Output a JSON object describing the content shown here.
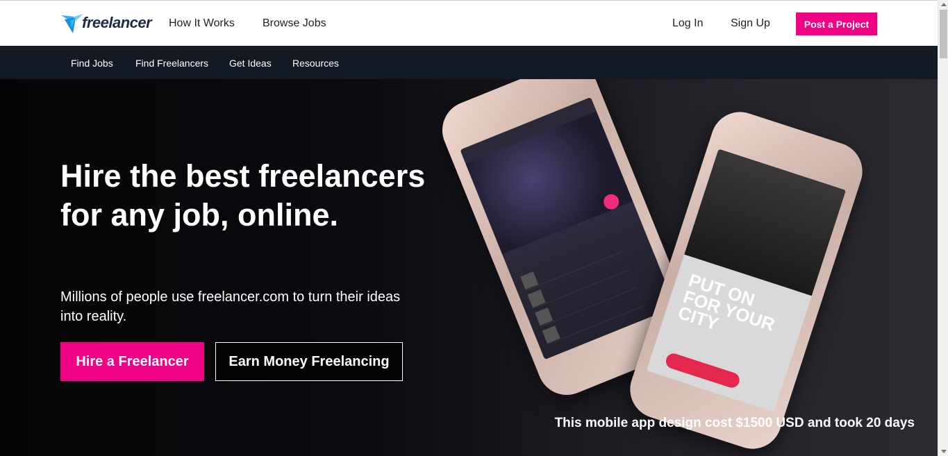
{
  "header": {
    "logo_text": "freelancer",
    "nav": [
      "How It Works",
      "Browse Jobs"
    ],
    "login": "Log In",
    "signup": "Sign Up",
    "post_project": "Post a Project"
  },
  "subnav": [
    "Find Jobs",
    "Find Freelancers",
    "Get Ideas",
    "Resources"
  ],
  "hero": {
    "title": "Hire the best freelancers for any job, online.",
    "subtitle": "Millions of people use freelancer.com to turn their ideas into reality.",
    "hire_button": "Hire a Freelancer",
    "earn_button": "Earn Money Freelancing",
    "caption": "This mobile app design cost $1500 USD and took 20 days"
  },
  "colors": {
    "accent": "#f10285",
    "logo_blue": "#29b2fe",
    "subnav_bg": "#131a23"
  }
}
